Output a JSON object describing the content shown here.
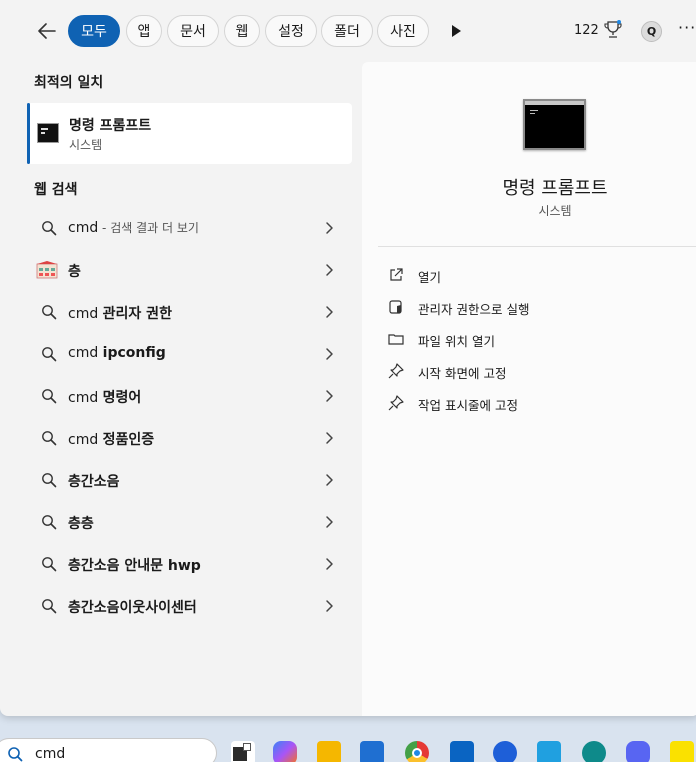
{
  "filters": {
    "tabs": [
      {
        "label": "모두",
        "active": true
      },
      {
        "label": "앱"
      },
      {
        "label": "문서"
      },
      {
        "label": "웹"
      },
      {
        "label": "설정"
      },
      {
        "label": "폴더"
      },
      {
        "label": "사진"
      }
    ],
    "points": "122",
    "avatar_letter": "Q",
    "more": "···"
  },
  "best_match": {
    "heading": "최적의 일치",
    "name": "명령 프롬프트",
    "subtitle": "시스템"
  },
  "web_search": {
    "heading": "웹 검색",
    "items": [
      {
        "prefix": "cmd",
        "hint": " - 검색 결과 더 보기",
        "bold": "",
        "icon": "search-icon"
      },
      {
        "prefix": "",
        "hint": "",
        "bold": "층",
        "icon": "building-thumbnail"
      },
      {
        "prefix": "cmd ",
        "hint": "",
        "bold": "관리자 권한",
        "icon": "search-icon"
      },
      {
        "prefix": "cmd ",
        "hint": "",
        "bold": "ipconfig",
        "icon": "search-icon"
      },
      {
        "prefix": "cmd ",
        "hint": "",
        "bold": "명령어",
        "icon": "search-icon"
      },
      {
        "prefix": "cmd ",
        "hint": "",
        "bold": "정품인증",
        "icon": "search-icon"
      },
      {
        "prefix": "",
        "hint": "",
        "bold": "층간소음",
        "icon": "search-icon"
      },
      {
        "prefix": "",
        "hint": "",
        "bold": "층층",
        "icon": "search-icon"
      },
      {
        "prefix": "",
        "hint": "",
        "bold": "층간소음 안내문 hwp",
        "icon": "search-icon"
      },
      {
        "prefix": "",
        "hint": "",
        "bold": "층간소음이웃사이센터",
        "icon": "search-icon"
      }
    ]
  },
  "detail": {
    "title": "명령 프롬프트",
    "subtitle": "시스템",
    "actions": [
      {
        "label": "열기",
        "icon": "open-external-icon"
      },
      {
        "label": "관리자 권한으로 실행",
        "icon": "shield-icon"
      },
      {
        "label": "파일 위치 열기",
        "icon": "folder-icon"
      },
      {
        "label": "시작 화면에 고정",
        "icon": "pin-icon"
      },
      {
        "label": "작업 표시줄에 고정",
        "icon": "pin-icon"
      }
    ]
  },
  "taskbar": {
    "search_value": "cmd",
    "colors": {
      "accent": "#0f62b3"
    }
  }
}
